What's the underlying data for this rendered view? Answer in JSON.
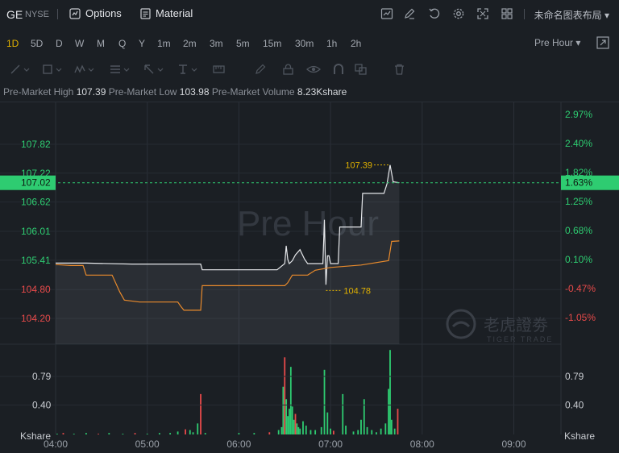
{
  "header": {
    "symbol": "GE",
    "exchange": "NYSE",
    "options_label": "Options",
    "material_label": "Material",
    "layout_label": "未命名图表布局",
    "icons": [
      "chart-icon",
      "draw-icon",
      "undo-icon",
      "gear-icon",
      "fullscreen-icon",
      "grid-icon"
    ]
  },
  "timeframes": [
    "1D",
    "5D",
    "D",
    "W",
    "M",
    "Q",
    "Y",
    "1m",
    "2m",
    "3m",
    "5m",
    "15m",
    "30m",
    "1h",
    "2h"
  ],
  "active_timeframe": "1D",
  "session_selector": "Pre Hour",
  "stats": {
    "high_label": "Pre-Market High",
    "high_value": "107.39",
    "low_label": "Pre-Market Low",
    "low_value": "103.98",
    "volume_label": "Pre-Market Volume",
    "volume_value": "8.23Kshare"
  },
  "watermark": "Pre Hour",
  "brand": {
    "name": "老虎證劵",
    "sub": "TIGER TRADE"
  },
  "colors": {
    "up": "#2ecc71",
    "down": "#e84a4a",
    "price_line": "#e6e8eb",
    "avg_line": "#e88a2c",
    "accent": "#e0b100"
  },
  "chart_data": {
    "type": "line",
    "session": "Pre-Market",
    "x_ticks": [
      "04:00",
      "05:00",
      "06:00",
      "07:00",
      "08:00",
      "09:00"
    ],
    "x_range_minutes": [
      0,
      330
    ],
    "y_price_ticks": [
      "107.82",
      "107.22",
      "106.62",
      "106.01",
      "105.41",
      "104.80",
      "104.20"
    ],
    "y_price_range": [
      103.6,
      108.7
    ],
    "y_pct_ticks": [
      "2.97%",
      "2.40%",
      "1.82%",
      "1.25%",
      "0.68%",
      "0.10%",
      "-0.47%",
      "-1.05%"
    ],
    "reference_close": 105.31,
    "current_price": "107.02",
    "current_pct": "1.63%",
    "high_marker": "107.39",
    "low_marker": "104.78",
    "volume_ticks": [
      "0.79",
      "0.40"
    ],
    "volume_unit": "Kshare",
    "volume_range": [
      0,
      1.25
    ],
    "series": [
      {
        "name": "price",
        "points": [
          [
            0,
            105.35
          ],
          [
            20,
            105.35
          ],
          [
            50,
            105.33
          ],
          [
            95,
            105.33
          ],
          [
            96,
            105.21
          ],
          [
            145,
            105.21
          ],
          [
            150,
            105.34
          ],
          [
            151,
            105.71
          ],
          [
            152,
            105.43
          ],
          [
            153,
            105.34
          ],
          [
            155,
            105.4
          ],
          [
            157,
            105.52
          ],
          [
            160,
            105.63
          ],
          [
            163,
            105.43
          ],
          [
            165,
            105.34
          ],
          [
            170,
            105.34
          ],
          [
            175,
            105.34
          ],
          [
            176,
            106.25
          ],
          [
            177,
            104.9
          ],
          [
            178,
            105.5
          ],
          [
            179,
            105.5
          ],
          [
            180,
            105.34
          ],
          [
            185,
            105.34
          ],
          [
            186,
            106.1
          ],
          [
            200,
            106.1
          ],
          [
            201,
            106.8
          ],
          [
            215,
            106.8
          ],
          [
            217,
            107.0
          ],
          [
            219,
            107.39
          ],
          [
            221,
            107.04
          ],
          [
            225,
            107.02
          ]
        ]
      },
      {
        "name": "average",
        "points": [
          [
            0,
            105.32
          ],
          [
            10,
            105.3
          ],
          [
            18,
            105.3
          ],
          [
            20,
            105.1
          ],
          [
            37,
            105.1
          ],
          [
            42,
            104.75
          ],
          [
            45,
            104.58
          ],
          [
            55,
            104.54
          ],
          [
            80,
            104.54
          ],
          [
            82,
            104.45
          ],
          [
            84,
            104.37
          ],
          [
            90,
            104.37
          ],
          [
            95,
            104.37
          ],
          [
            96,
            104.88
          ],
          [
            150,
            104.88
          ],
          [
            152,
            104.94
          ],
          [
            155,
            105.1
          ],
          [
            165,
            105.1
          ],
          [
            170,
            105.2
          ],
          [
            180,
            105.26
          ],
          [
            200,
            105.31
          ],
          [
            218,
            105.4
          ],
          [
            220,
            105.8
          ],
          [
            225,
            105.81
          ]
        ]
      }
    ],
    "volume": [
      [
        1,
        0.01,
        "up"
      ],
      [
        5,
        0.02,
        "down"
      ],
      [
        12,
        0.01,
        "up"
      ],
      [
        20,
        0.02,
        "up"
      ],
      [
        28,
        0.01,
        "down"
      ],
      [
        35,
        0.02,
        "up"
      ],
      [
        44,
        0.01,
        "up"
      ],
      [
        52,
        0.02,
        "down"
      ],
      [
        60,
        0.01,
        "up"
      ],
      [
        68,
        0.02,
        "up"
      ],
      [
        75,
        0.02,
        "up"
      ],
      [
        80,
        0.04,
        "up"
      ],
      [
        85,
        0.07,
        "down"
      ],
      [
        88,
        0.06,
        "up"
      ],
      [
        90,
        0.03,
        "up"
      ],
      [
        93,
        0.15,
        "up"
      ],
      [
        95,
        0.55,
        "down"
      ],
      [
        98,
        0.02,
        "up"
      ],
      [
        120,
        0.02,
        "up"
      ],
      [
        130,
        0.02,
        "up"
      ],
      [
        140,
        0.03,
        "down"
      ],
      [
        146,
        0.06,
        "up"
      ],
      [
        148,
        0.1,
        "up"
      ],
      [
        149,
        0.65,
        "up"
      ],
      [
        150,
        1.05,
        "down"
      ],
      [
        151,
        0.48,
        "up"
      ],
      [
        152,
        0.25,
        "up"
      ],
      [
        153,
        0.35,
        "up"
      ],
      [
        154,
        0.92,
        "up"
      ],
      [
        155,
        0.38,
        "up"
      ],
      [
        156,
        0.2,
        "up"
      ],
      [
        157,
        0.28,
        "down"
      ],
      [
        158,
        0.15,
        "up"
      ],
      [
        159,
        0.1,
        "up"
      ],
      [
        160,
        0.08,
        "up"
      ],
      [
        162,
        0.18,
        "up"
      ],
      [
        164,
        0.12,
        "up"
      ],
      [
        167,
        0.06,
        "up"
      ],
      [
        170,
        0.06,
        "up"
      ],
      [
        174,
        0.1,
        "up"
      ],
      [
        176,
        0.88,
        "up"
      ],
      [
        178,
        0.3,
        "up"
      ],
      [
        180,
        0.08,
        "up"
      ],
      [
        182,
        0.05,
        "down"
      ],
      [
        188,
        0.55,
        "up"
      ],
      [
        190,
        0.12,
        "up"
      ],
      [
        195,
        0.04,
        "up"
      ],
      [
        198,
        0.06,
        "up"
      ],
      [
        200,
        0.2,
        "up"
      ],
      [
        202,
        0.48,
        "up"
      ],
      [
        204,
        0.1,
        "up"
      ],
      [
        207,
        0.06,
        "up"
      ],
      [
        210,
        0.03,
        "up"
      ],
      [
        213,
        0.08,
        "up"
      ],
      [
        216,
        0.15,
        "up"
      ],
      [
        218,
        0.62,
        "up"
      ],
      [
        219,
        1.15,
        "up"
      ],
      [
        220,
        0.2,
        "up"
      ],
      [
        222,
        0.08,
        "up"
      ],
      [
        224,
        0.35,
        "down"
      ]
    ]
  }
}
